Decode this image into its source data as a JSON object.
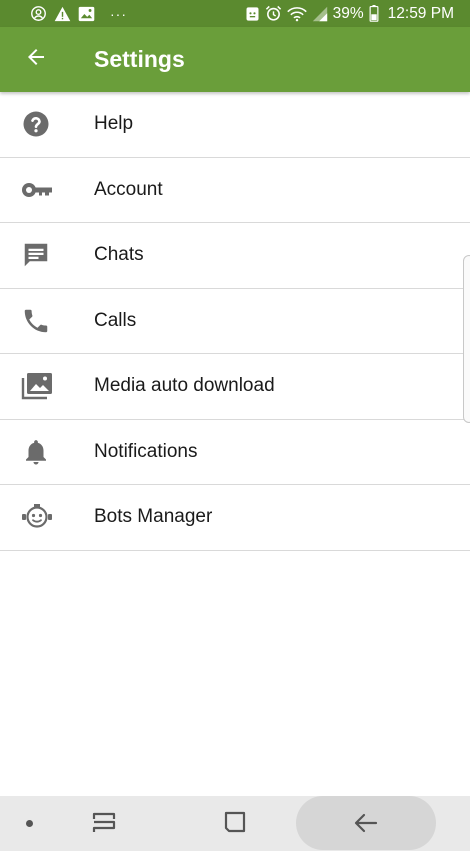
{
  "status_bar": {
    "icons": [
      "account-circle-icon",
      "warning-icon",
      "image-icon",
      "more-dots-icon",
      "android-debug-icon",
      "alarm-icon",
      "wifi-icon",
      "signal-icon",
      "battery-icon"
    ],
    "dots": "···",
    "battery": "39%",
    "time": "12:59 PM"
  },
  "app_bar": {
    "title": "Settings",
    "back_icon": "arrow-back-icon"
  },
  "settings": [
    {
      "label": "Help",
      "icon": "help-icon"
    },
    {
      "label": "Account",
      "icon": "key-icon"
    },
    {
      "label": "Chats",
      "icon": "chat-icon"
    },
    {
      "label": "Calls",
      "icon": "phone-icon"
    },
    {
      "label": "Media auto download",
      "icon": "photo-library-icon"
    },
    {
      "label": "Notifications",
      "icon": "bell-icon"
    },
    {
      "label": "Bots Manager",
      "icon": "bot-icon"
    }
  ],
  "nav_bar": {
    "buttons": [
      "nav-dot-icon",
      "recents-icon",
      "home-icon",
      "back-icon"
    ]
  },
  "colors": {
    "app_bar": "#6a9e3a",
    "status_bar": "#5b8a2f",
    "icon_grey": "#6b6b6b",
    "divider": "#d9d9d9"
  }
}
